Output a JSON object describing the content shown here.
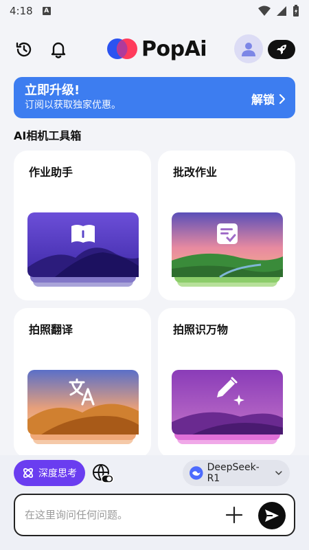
{
  "status_bar": {
    "time": "4:18",
    "notification_badge": "A"
  },
  "header": {
    "logo_text": "PopAi"
  },
  "banner": {
    "title": "立即升级!",
    "subtitle": "订阅以获取独家优惠。",
    "unlock_label": "解锁"
  },
  "section": {
    "title": "AI相机工具箱"
  },
  "tools": [
    {
      "label": "作业助手",
      "icon": "book-icon"
    },
    {
      "label": "批改作业",
      "icon": "checklist-icon"
    },
    {
      "label": "拍照翻译",
      "icon": "translate-icon"
    },
    {
      "label": "拍照识万物",
      "icon": "pencil-sparkle-icon"
    }
  ],
  "bottom": {
    "deep_think_label": "深度思考",
    "model_label": "DeepSeek-R1",
    "input_placeholder": "在这里询问任何问题。"
  },
  "colors": {
    "accent": "#3d7df0",
    "deep_think": "#6a3df0"
  }
}
